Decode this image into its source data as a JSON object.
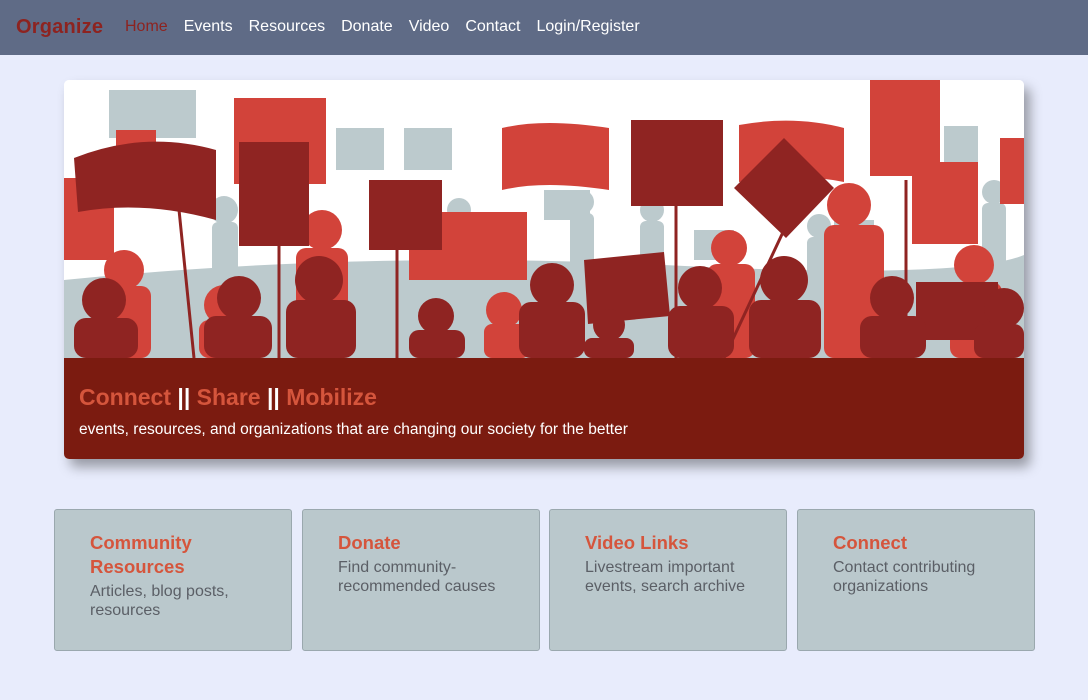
{
  "navbar": {
    "brand": "Organize",
    "links": [
      {
        "label": "Home",
        "active": true
      },
      {
        "label": "Events"
      },
      {
        "label": "Resources"
      },
      {
        "label": "Donate"
      },
      {
        "label": "Video"
      },
      {
        "label": "Contact"
      },
      {
        "label": "Login/Register"
      }
    ]
  },
  "hero": {
    "image_alt": "protest-crowd-illustration",
    "title": {
      "part1": "Connect",
      "sep1": " || ",
      "part2": "Share",
      "sep2": " || ",
      "part3": "Mobilize"
    },
    "subtitle": "events, resources, and organizations that are changing our society for the better"
  },
  "cards": [
    {
      "title": "Community Resources",
      "text": "Articles, blog posts, resources"
    },
    {
      "title": "Donate",
      "text": "Find community-recommended causes"
    },
    {
      "title": "Video Links",
      "text": "Livestream important events, search archive"
    },
    {
      "title": "Connect",
      "text": "Contact contributing organizations"
    }
  ],
  "colors": {
    "navbar_bg": "#5f6b86",
    "brand": "#8d2320",
    "accent": "#d5553c",
    "caption_bg": "#7b1b10",
    "card_bg": "#bac8cc",
    "page_bg": "#e8ecfc"
  }
}
